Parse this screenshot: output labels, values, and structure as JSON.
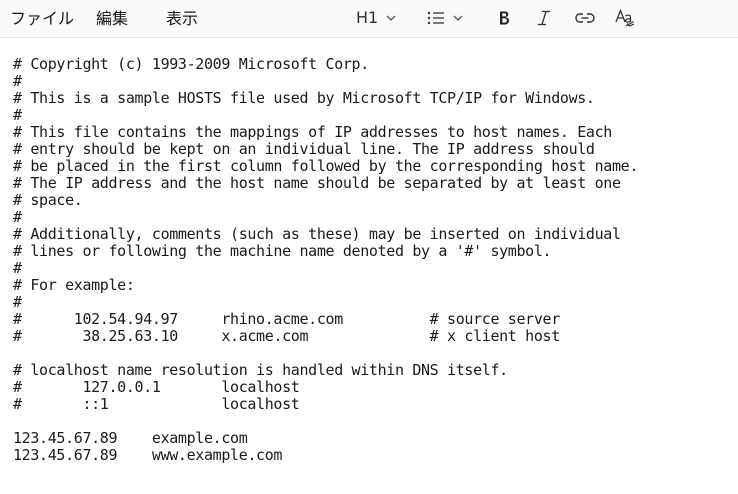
{
  "menu": {
    "file": "ファイル",
    "edit": "編集",
    "view": "表示"
  },
  "toolbar": {
    "heading_label": "H1",
    "heading_icon": "chevron-down-icon",
    "list_icon": "bulleted-list-icon",
    "bold_icon": "bold-icon",
    "italic_icon": "italic-icon",
    "link_icon": "link-icon",
    "clear_format_icon": "clear-formatting-icon"
  },
  "document": {
    "lines": [
      "# Copyright (c) 1993-2009 Microsoft Corp.",
      "#",
      "# This is a sample HOSTS file used by Microsoft TCP/IP for Windows.",
      "#",
      "# This file contains the mappings of IP addresses to host names. Each",
      "# entry should be kept on an individual line. The IP address should",
      "# be placed in the first column followed by the corresponding host name.",
      "# The IP address and the host name should be separated by at least one",
      "# space.",
      "#",
      "# Additionally, comments (such as these) may be inserted on individual",
      "# lines or following the machine name denoted by a '#' symbol.",
      "#",
      "# For example:",
      "#",
      "#      102.54.94.97     rhino.acme.com          # source server",
      "#       38.25.63.10     x.acme.com              # x client host",
      "",
      "# localhost name resolution is handled within DNS itself.",
      "#       127.0.0.1       localhost",
      "#       ::1             localhost",
      "",
      "123.45.67.89    example.com",
      "123.45.67.89    www.example.com"
    ]
  }
}
